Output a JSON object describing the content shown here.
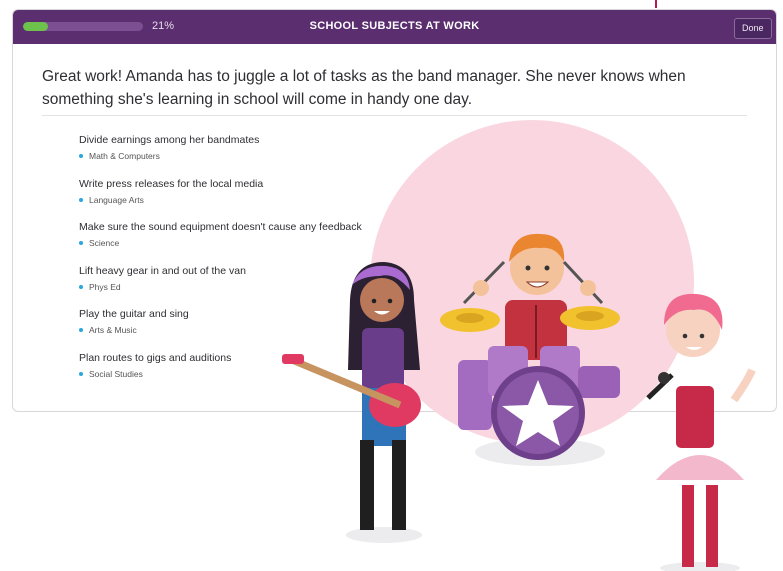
{
  "header": {
    "progress_percent": 21,
    "progress_label": "21%",
    "title": "SCHOOL SUBJECTS AT WORK",
    "done_label": "Done"
  },
  "intro_text": "Great work! Amanda has to juggle a lot of tasks as the band manager. She never knows when something she's learning in school will come in handy one day.",
  "tasks": [
    {
      "text": "Divide earnings among her bandmates",
      "subject": "Math & Computers"
    },
    {
      "text": "Write press releases for the local media",
      "subject": "Language Arts"
    },
    {
      "text": "Make sure the sound equipment doesn't cause any feedback",
      "subject": "Science"
    },
    {
      "text": "Lift heavy gear in and out of the van",
      "subject": "Phys Ed"
    },
    {
      "text": "Play the guitar and sing",
      "subject": "Arts & Music"
    },
    {
      "text": "Plan routes to gigs and auditions",
      "subject": "Social Studies"
    }
  ],
  "colors": {
    "header_bg": "#5a2e6f",
    "progress_fill": "#6cc24a",
    "bullet": "#2aa7df",
    "circle_bg": "#f9d6e0"
  },
  "illustration": {
    "description_icons": [
      "guitarist-icon",
      "drummer-icon",
      "singer-icon"
    ]
  }
}
